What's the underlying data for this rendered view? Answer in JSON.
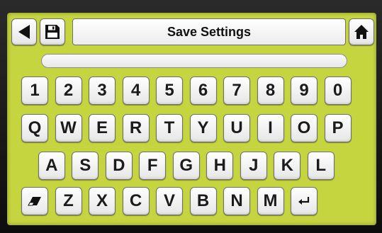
{
  "header": {
    "title": "Save Settings",
    "back_icon": "back-arrow-icon",
    "save_icon": "floppy-disk-icon",
    "home_icon": "home-icon"
  },
  "entry": {
    "value": ""
  },
  "keyboard": {
    "row1": [
      "1",
      "2",
      "3",
      "4",
      "5",
      "6",
      "7",
      "8",
      "9",
      "0"
    ],
    "row2": [
      "Q",
      "W",
      "E",
      "R",
      "T",
      "Y",
      "U",
      "I",
      "O",
      "P"
    ],
    "row3": [
      "A",
      "S",
      "D",
      "F",
      "G",
      "H",
      "J",
      "K",
      "L"
    ],
    "row4": [
      "Z",
      "X",
      "C",
      "V",
      "B",
      "N",
      "M"
    ],
    "erase_icon": "eraser-icon",
    "enter_icon": "enter-icon"
  },
  "colors": {
    "screen_background": "#c5d540",
    "key_face": "#f5f5f5",
    "key_border": "#6f6f6f",
    "text": "#1b1b1b"
  }
}
